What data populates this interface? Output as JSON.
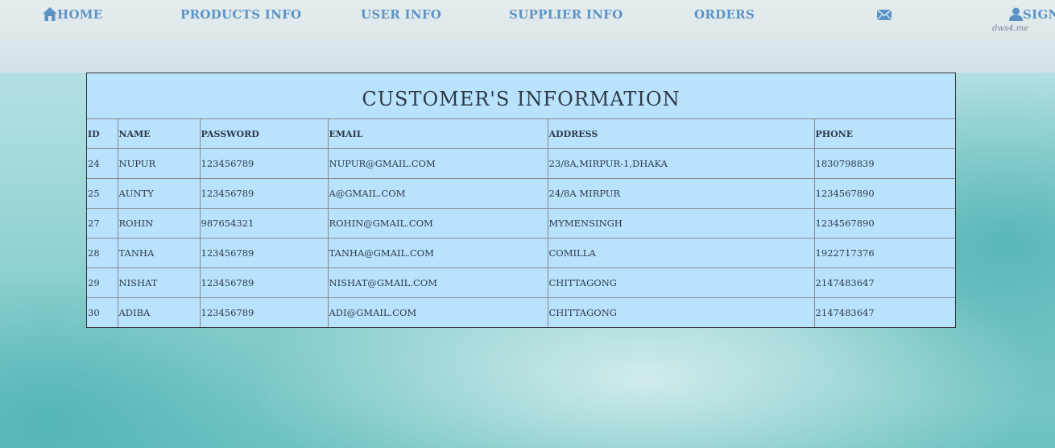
{
  "nav": {
    "home": "Home",
    "products_info": "Products Info",
    "user_info": "User Info",
    "supplier_info": "Supplier Info",
    "orders": "Orders",
    "mail_icon": "mail-icon",
    "sign": "Sign"
  },
  "watermark": "dws4.me",
  "table": {
    "title": "Customer's Information",
    "headers": [
      "ID",
      "Name",
      "Password",
      "Email",
      "Address",
      "Phone"
    ],
    "rows": [
      [
        "24",
        "Nupur",
        "123456789",
        "nupur@gmail.com",
        "23/8A,Mirpur-1,Dhaka",
        "1830798839"
      ],
      [
        "25",
        "Aunty",
        "123456789",
        "a@gmail.com",
        "24/8A Mirpur",
        "1234567890"
      ],
      [
        "27",
        "Rohin",
        "987654321",
        "rohin@gmail.com",
        "Mymensingh",
        "1234567890"
      ],
      [
        "28",
        "Tanha",
        "123456789",
        "tanha@gmail.com",
        "Comilla",
        "1922717376"
      ],
      [
        "29",
        "Nishat",
        "123456789",
        "nishat@gmail.com",
        "Chittagong",
        "2147483647"
      ],
      [
        "30",
        "Adiba",
        "123456789",
        "adi@gmail.com",
        "Chittagong",
        "2147483647"
      ]
    ]
  },
  "colors": {
    "nav_text": "#5b93c7",
    "table_bg": "#b9e2ff",
    "text": "#2d3a45"
  }
}
